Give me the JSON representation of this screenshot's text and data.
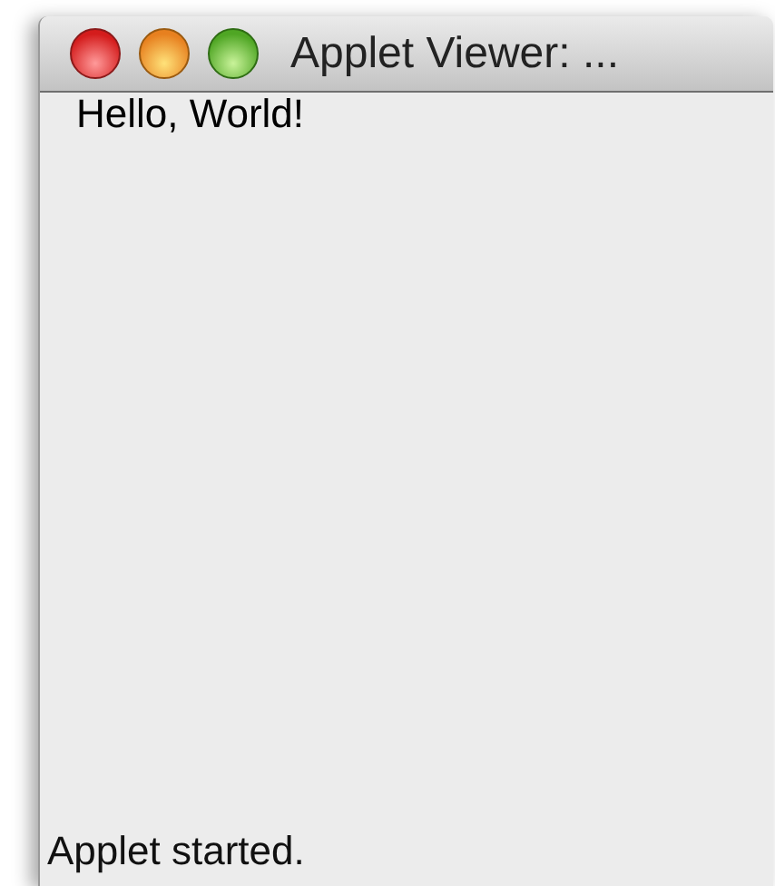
{
  "window": {
    "title": "Applet Viewer: ..."
  },
  "applet": {
    "text": "Hello, World!"
  },
  "status_bar": {
    "text": "Applet started."
  }
}
